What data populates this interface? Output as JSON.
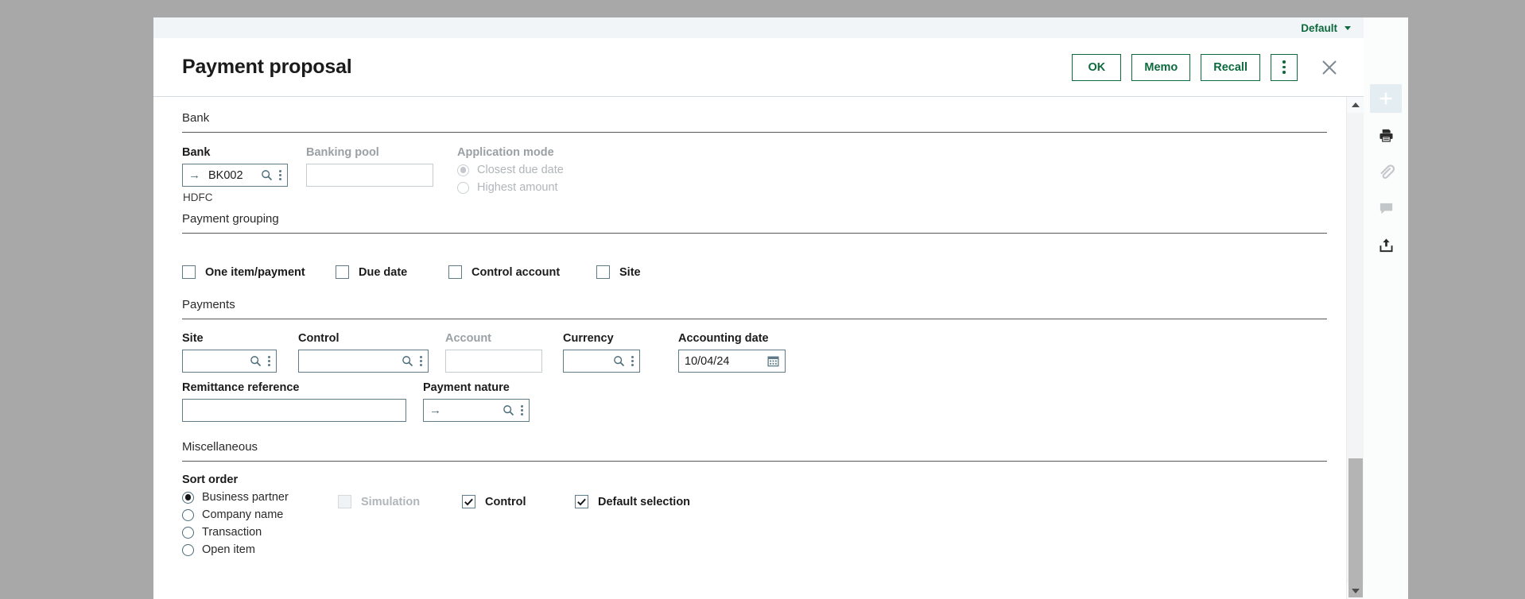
{
  "window": {
    "default_selector": "Default",
    "title": "Payment proposal",
    "buttons": {
      "ok": "OK",
      "memo": "Memo",
      "recall": "Recall"
    },
    "kebab_icon": "kebab-menu-icon",
    "close_icon": "close-icon"
  },
  "sections": {
    "bank": {
      "heading": "Bank",
      "bank_label": "Bank",
      "bank_value": "BK002",
      "bank_helper": "HDFC",
      "banking_pool_label": "Banking pool",
      "banking_pool_value": "",
      "application_mode_label": "Application mode",
      "application_modes": [
        {
          "label": "Closest due date",
          "selected": true
        },
        {
          "label": "Highest amount",
          "selected": false
        }
      ]
    },
    "payment_grouping": {
      "heading": "Payment grouping",
      "options": [
        {
          "label": "One item/payment",
          "checked": false
        },
        {
          "label": "Due date",
          "checked": false
        },
        {
          "label": "Control account",
          "checked": false
        },
        {
          "label": "Site",
          "checked": false
        }
      ]
    },
    "payments": {
      "heading": "Payments",
      "site_label": "Site",
      "site_value": "",
      "control_label": "Control",
      "control_value": "",
      "account_label": "Account",
      "account_value": "",
      "currency_label": "Currency",
      "currency_value": "",
      "accounting_date_label": "Accounting date",
      "accounting_date_value": "10/04/24",
      "remittance_label": "Remittance reference",
      "remittance_value": "",
      "payment_nature_label": "Payment nature",
      "payment_nature_value": ""
    },
    "miscellaneous": {
      "heading": "Miscellaneous",
      "sort_order_label": "Sort order",
      "sort_order_options": [
        {
          "label": "Business partner",
          "selected": true
        },
        {
          "label": "Company name",
          "selected": false
        },
        {
          "label": "Transaction",
          "selected": false
        },
        {
          "label": "Open item",
          "selected": false
        }
      ],
      "flags": [
        {
          "label": "Simulation",
          "checked": false,
          "disabled": true
        },
        {
          "label": "Control",
          "checked": true,
          "disabled": false
        },
        {
          "label": "Default selection",
          "checked": true,
          "disabled": false
        }
      ]
    }
  },
  "rail": {
    "items": [
      {
        "icon": "plus-icon"
      },
      {
        "icon": "printer-icon"
      },
      {
        "icon": "paperclip-icon"
      },
      {
        "icon": "comment-icon"
      },
      {
        "icon": "share-icon"
      }
    ]
  },
  "colors": {
    "accent_green": "#0d6a3d",
    "field_border": "#5e7b87",
    "disabled_text": "#9aa0a4"
  }
}
